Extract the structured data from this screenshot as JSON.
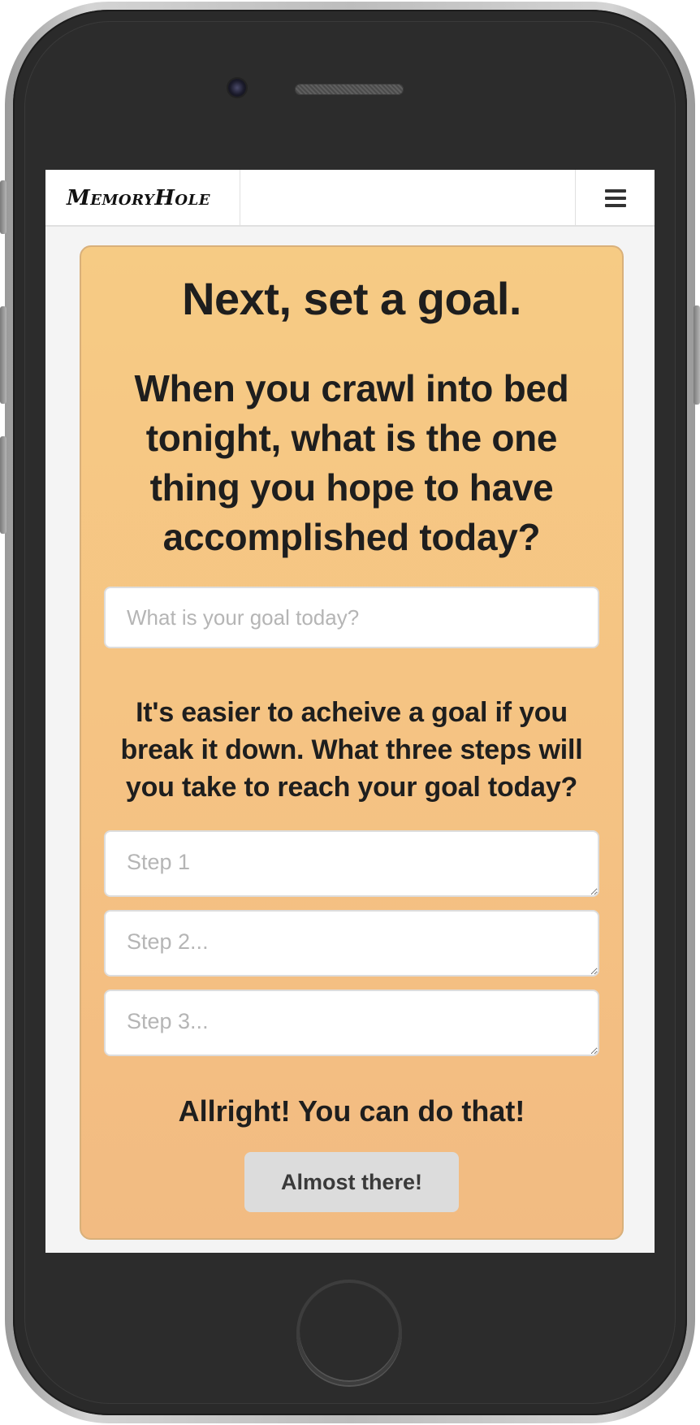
{
  "app": {
    "brand": "MemoryHole"
  },
  "icons": {
    "menu": "hamburger-menu-icon"
  },
  "goal_card": {
    "title": "Next, set a goal.",
    "question": "When you crawl into bed tonight, what is the one thing you hope to have accomplished today?",
    "goal_placeholder": "What is your goal today?",
    "steps_prompt": "It's easier to acheive a goal if you break it down. What three steps will you take to reach your goal today?",
    "steps": [
      {
        "placeholder": "Step 1"
      },
      {
        "placeholder": "Step 2..."
      },
      {
        "placeholder": "Step 3..."
      }
    ],
    "encouragement": "Allright! You can do that!",
    "submit_label": "Almost there!"
  },
  "colors": {
    "card_top": "#f6cb84",
    "card_bottom": "#f2bb82",
    "button_bg": "#dcdcdc",
    "screen_bg": "#f4f4f4"
  }
}
